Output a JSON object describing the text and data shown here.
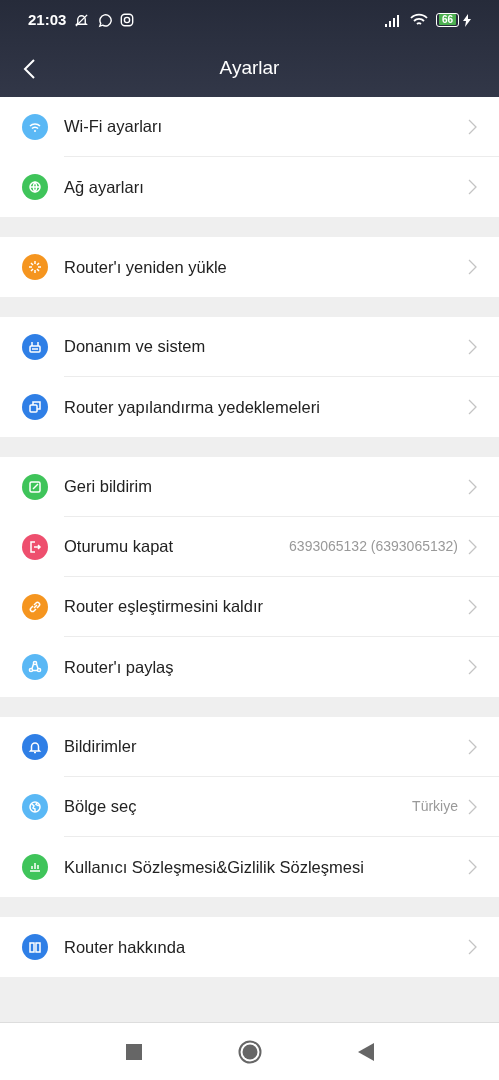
{
  "status_bar": {
    "time": "21:03",
    "battery": "66"
  },
  "header": {
    "title": "Ayarlar"
  },
  "groups": [
    {
      "items": [
        {
          "label": "Wi-Fi ayarları",
          "color": "#5ab8f5"
        },
        {
          "label": "Ağ ayarları",
          "color": "#3fc45a"
        }
      ]
    },
    {
      "items": [
        {
          "label": "Router'ı yeniden yükle",
          "color": "#f5951f"
        }
      ]
    },
    {
      "items": [
        {
          "label": "Donanım ve sistem",
          "color": "#2f7fe6"
        },
        {
          "label": "Router yapılandırma yedeklemeleri",
          "color": "#2f7fe6"
        }
      ]
    },
    {
      "items": [
        {
          "label": "Geri bildirim",
          "color": "#3fc45a"
        },
        {
          "label": "Oturumu kapat",
          "value": "6393065132 (6393065132)",
          "color": "#ee4f6e"
        },
        {
          "label": "Router eşleştirmesini kaldır",
          "color": "#f5951f"
        },
        {
          "label": "Router'ı paylaş",
          "color": "#5ab8f5"
        }
      ]
    },
    {
      "items": [
        {
          "label": "Bildirimler",
          "color": "#2f7fe6"
        },
        {
          "label": "Bölge seç",
          "value": "Türkiye",
          "color": "#5ab8f5"
        },
        {
          "label": "Kullanıcı Sözleşmesi&Gizlilik Sözleşmesi",
          "color": "#3fc45a"
        }
      ]
    },
    {
      "items": [
        {
          "label": "Router hakkında",
          "color": "#2f7fe6"
        }
      ]
    }
  ]
}
